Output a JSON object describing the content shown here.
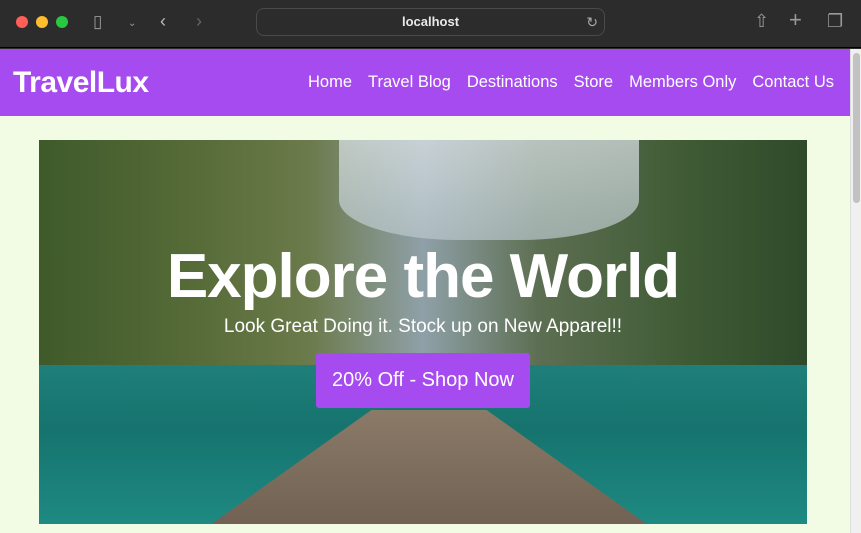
{
  "browser": {
    "url": "localhost",
    "icons": {
      "sidebar": "sidebar-icon",
      "back": "chevron-left-icon",
      "forward": "chevron-right-icon",
      "reload": "reload-icon",
      "share": "share-icon",
      "new_tab": "plus-icon",
      "tabs": "tabs-icon"
    }
  },
  "nav": {
    "logo": "TravelLux",
    "links": [
      "Home",
      "Travel Blog",
      "Destinations",
      "Store",
      "Members Only",
      "Contact Us"
    ]
  },
  "hero": {
    "title": "Explore the World",
    "subtitle": "Look Great Doing it. Stock up on New Apparel!!",
    "cta": "20% Off - Shop Now"
  },
  "colors": {
    "brand": "#a64bf0",
    "page_bg": "#f2fce4"
  }
}
